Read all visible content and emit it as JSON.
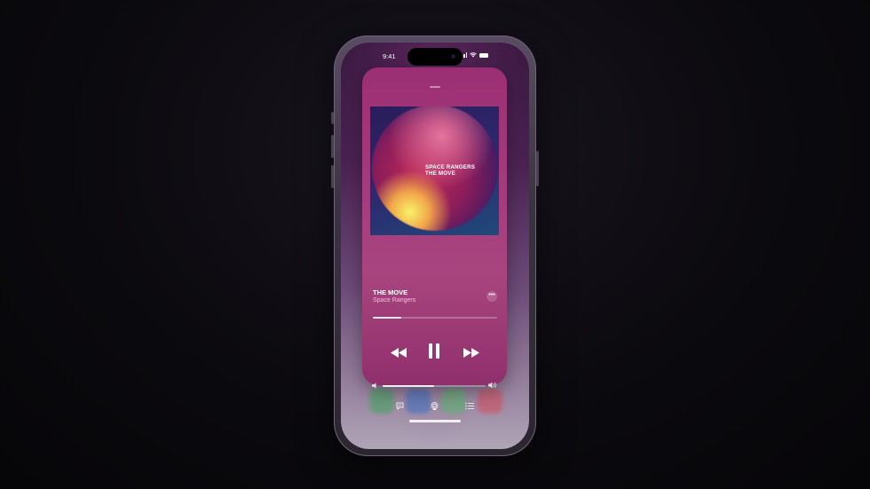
{
  "status_bar": {
    "time": "9:41"
  },
  "now_playing": {
    "album_art_text_line1": "SPACE RANGERS",
    "album_art_text_line2": "THE MOVE",
    "title": "THE MOVE",
    "artist": "Space Rangers",
    "progress_fraction": 0.23,
    "volume_fraction": 0.5
  },
  "controls": {
    "rewind_icon": "rewind-icon",
    "pause_icon": "pause-icon",
    "forward_icon": "fast-forward-icon",
    "more_icon": "ellipsis-icon"
  },
  "bottom_bar": {
    "lyrics_icon": "lyrics-icon",
    "airplay_icon": "airplay-icon",
    "queue_icon": "queue-list-icon"
  },
  "colors": {
    "card_accent": "#a33a7c",
    "background": "#0b0a0e"
  }
}
